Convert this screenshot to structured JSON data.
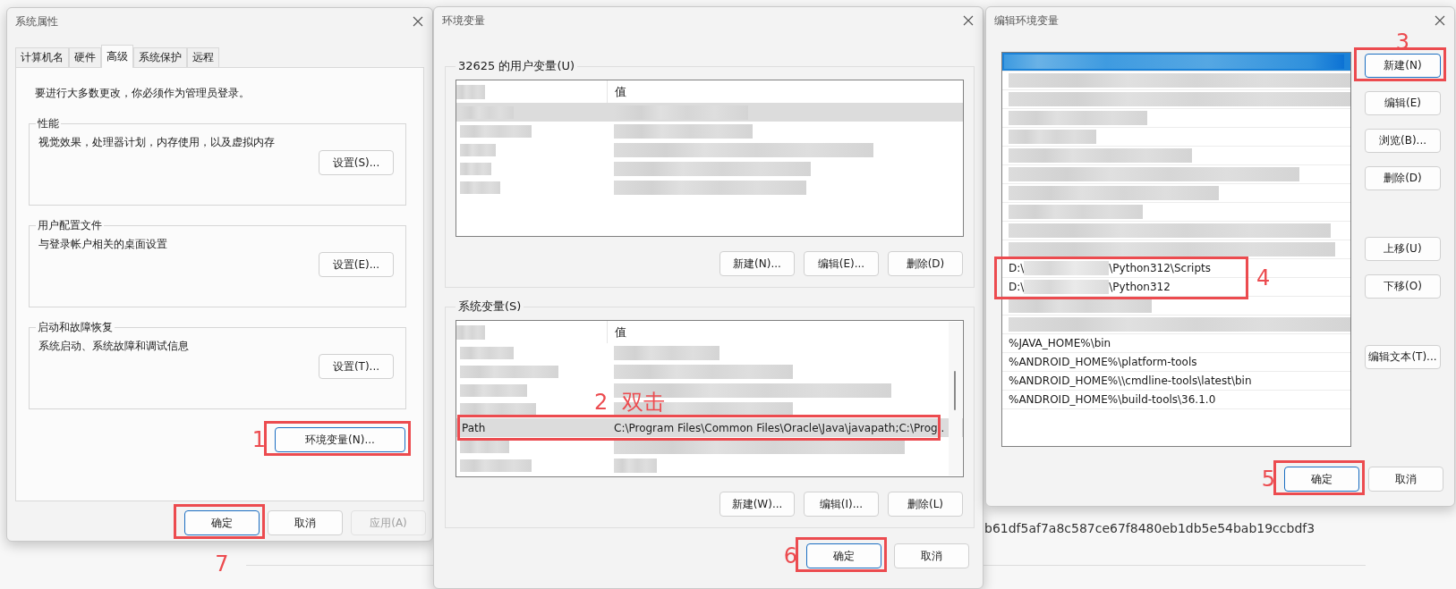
{
  "desktop": {
    "page_text": "b61df5af7a8c587ce67f8480eb1db5e54bab19ccbdf3"
  },
  "system_properties": {
    "title": "系统属性",
    "tabs": [
      {
        "label": "计算机名",
        "selected": false
      },
      {
        "label": "硬件",
        "selected": false
      },
      {
        "label": "高级",
        "selected": true
      },
      {
        "label": "系统保护",
        "selected": false
      },
      {
        "label": "远程",
        "selected": false
      }
    ],
    "notice": "要进行大多数更改，你必须作为管理员登录。",
    "groups": [
      {
        "title": "性能",
        "description": "视觉效果，处理器计划，内存使用，以及虚拟内存",
        "button": "设置(S)..."
      },
      {
        "title": "用户配置文件",
        "description": "与登录帐户相关的桌面设置",
        "button": "设置(E)..."
      },
      {
        "title": "启动和故障恢复",
        "description": "系统启动、系统故障和调试信息",
        "button": "设置(T)..."
      }
    ],
    "env_button": {
      "label": "环境变量(N)...",
      "highlighted": true,
      "callout": "1"
    },
    "buttons": [
      {
        "label": "确定",
        "highlighted": true,
        "callout": "7",
        "disabled": false
      },
      {
        "label": "取消",
        "highlighted": false,
        "disabled": false
      },
      {
        "label": "应用(A)",
        "highlighted": false,
        "disabled": true
      }
    ]
  },
  "environment_variables": {
    "title": "环境变量",
    "sections": [
      {
        "title": "32625 的用户变量(U)",
        "value_header": "值",
        "scrollbar": false,
        "rows": [
          {
            "kind": "blurred",
            "selected": true,
            "highlighted": false
          },
          {
            "kind": "blurred",
            "selected": false,
            "highlighted": false
          },
          {
            "kind": "blurred",
            "selected": false,
            "highlighted": false
          },
          {
            "kind": "blurred",
            "selected": false,
            "highlighted": false
          },
          {
            "kind": "blurred",
            "selected": false,
            "highlighted": false
          }
        ],
        "buttons": [
          {
            "label": "新建(N)..."
          },
          {
            "label": "编辑(E)..."
          },
          {
            "label": "删除(D)"
          }
        ]
      },
      {
        "title": "系统变量(S)",
        "value_header": "值",
        "scrollbar": true,
        "rows": [
          {
            "kind": "blurred",
            "selected": false,
            "highlighted": false
          },
          {
            "kind": "blurred",
            "selected": false,
            "highlighted": false
          },
          {
            "kind": "blurred",
            "selected": false,
            "highlighted": false
          },
          {
            "kind": "blurred",
            "selected": false,
            "highlighted": false
          },
          {
            "kind": "text",
            "variable": "Path",
            "value": "C:\\Program Files\\Common Files\\Oracle\\Java\\javapath;C:\\Prog..",
            "selected": true,
            "highlighted": true,
            "callout": "2  双击"
          },
          {
            "kind": "blurred",
            "selected": false,
            "highlighted": false
          },
          {
            "kind": "blurred",
            "selected": false,
            "highlighted": false
          }
        ],
        "buttons": [
          {
            "label": "新建(W)..."
          },
          {
            "label": "编辑(I)..."
          },
          {
            "label": "删除(L)"
          }
        ]
      }
    ],
    "buttons": [
      {
        "label": "确定",
        "highlighted": true,
        "callout": "6"
      },
      {
        "label": "取消",
        "highlighted": false
      }
    ]
  },
  "edit_variable": {
    "title": "编辑环境变量",
    "entries": [
      {
        "kind": "blurred",
        "selected": true,
        "highlighted": false
      },
      {
        "kind": "blurred",
        "selected": false,
        "highlighted": false
      },
      {
        "kind": "blurred",
        "selected": false,
        "highlighted": false
      },
      {
        "kind": "blurred",
        "selected": false,
        "highlighted": false
      },
      {
        "kind": "blurred",
        "selected": false,
        "highlighted": false
      },
      {
        "kind": "blurred",
        "selected": false,
        "highlighted": false
      },
      {
        "kind": "blurred",
        "selected": false,
        "highlighted": false
      },
      {
        "kind": "blurred",
        "selected": false,
        "highlighted": false
      },
      {
        "kind": "blurred",
        "selected": false,
        "highlighted": false
      },
      {
        "kind": "blurred",
        "selected": false,
        "highlighted": false
      },
      {
        "kind": "blurred",
        "selected": false,
        "highlighted": false
      },
      {
        "kind": "partial",
        "prefix": "D:\\",
        "suffix": "\\Python312\\Scripts",
        "selected": false,
        "highlighted": true,
        "callout": "4"
      },
      {
        "kind": "partial",
        "prefix": "D:\\",
        "suffix": "\\Python312",
        "selected": false,
        "highlighted": true
      },
      {
        "kind": "blurred",
        "selected": false,
        "highlighted": false
      },
      {
        "kind": "blurred",
        "selected": false,
        "highlighted": false
      },
      {
        "kind": "text",
        "text": "%JAVA_HOME%\\bin",
        "selected": false,
        "highlighted": false
      },
      {
        "kind": "text",
        "text": "%ANDROID_HOME%\\platform-tools",
        "selected": false,
        "highlighted": false
      },
      {
        "kind": "text",
        "text": "%ANDROID_HOME%\\\\cmdline-tools\\latest\\bin",
        "selected": false,
        "highlighted": false
      },
      {
        "kind": "text",
        "text": "%ANDROID_HOME%\\build-tools\\36.1.0",
        "selected": false,
        "highlighted": false
      }
    ],
    "side_buttons": [
      {
        "label": "新建(N)",
        "highlighted": true,
        "callout": "3"
      },
      {
        "label": "编辑(E)",
        "highlighted": false
      },
      {
        "label": "浏览(B)...",
        "highlighted": false
      },
      {
        "label": "删除(D)",
        "highlighted": false
      },
      {
        "label": "上移(U)",
        "highlighted": false
      },
      {
        "label": "下移(O)",
        "highlighted": false
      },
      {
        "label": "编辑文本(T)...",
        "highlighted": false
      }
    ],
    "buttons": [
      {
        "label": "确定",
        "highlighted": true,
        "callout": "5"
      },
      {
        "label": "取消",
        "highlighted": false
      }
    ]
  }
}
